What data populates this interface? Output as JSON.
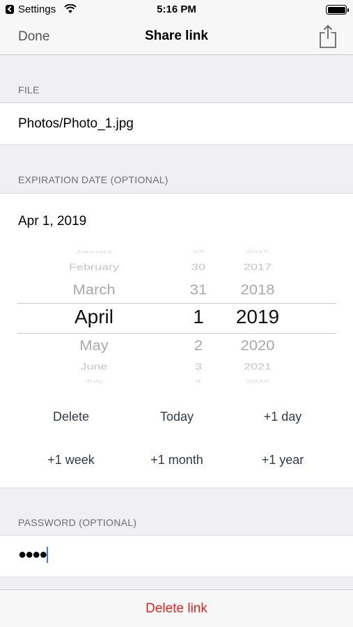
{
  "status_bar": {
    "back_app": "Settings",
    "time": "5:16 PM",
    "battery_level": 1.0,
    "icons": [
      "back-arrow-icon",
      "wifi-icon",
      "battery-icon"
    ]
  },
  "nav": {
    "done": "Done",
    "title": "Share link",
    "share_icon": "share-icon"
  },
  "file": {
    "header": "FILE",
    "path": "Photos/Photo_1.jpg"
  },
  "expiration": {
    "header": "EXPIRATION DATE (OPTIONAL)",
    "value": "Apr 1, 2019",
    "picker": {
      "months": [
        "January",
        "February",
        "March",
        "April",
        "May",
        "June",
        "July"
      ],
      "days": [
        "29",
        "30",
        "31",
        "1",
        "2",
        "3",
        "4"
      ],
      "years": [
        "2016",
        "2017",
        "2018",
        "2019",
        "2020",
        "2021",
        "2022"
      ],
      "selected": {
        "month": "April",
        "day": "1",
        "year": "2019"
      }
    },
    "quick_buttons": {
      "delete": "Delete",
      "today": "Today",
      "plus_day": "+1 day",
      "plus_week": "+1 week",
      "plus_month": "+1 month",
      "plus_year": "+1 year"
    }
  },
  "password": {
    "header": "PASSWORD (OPTIONAL)",
    "masked_value": "●●●●"
  },
  "footer": {
    "delete_link": "Delete link"
  },
  "colors": {
    "background": "#efeff4",
    "bar": "#f7f7f7",
    "destructive": "#e8221e",
    "cursor": "#4a78e0"
  }
}
